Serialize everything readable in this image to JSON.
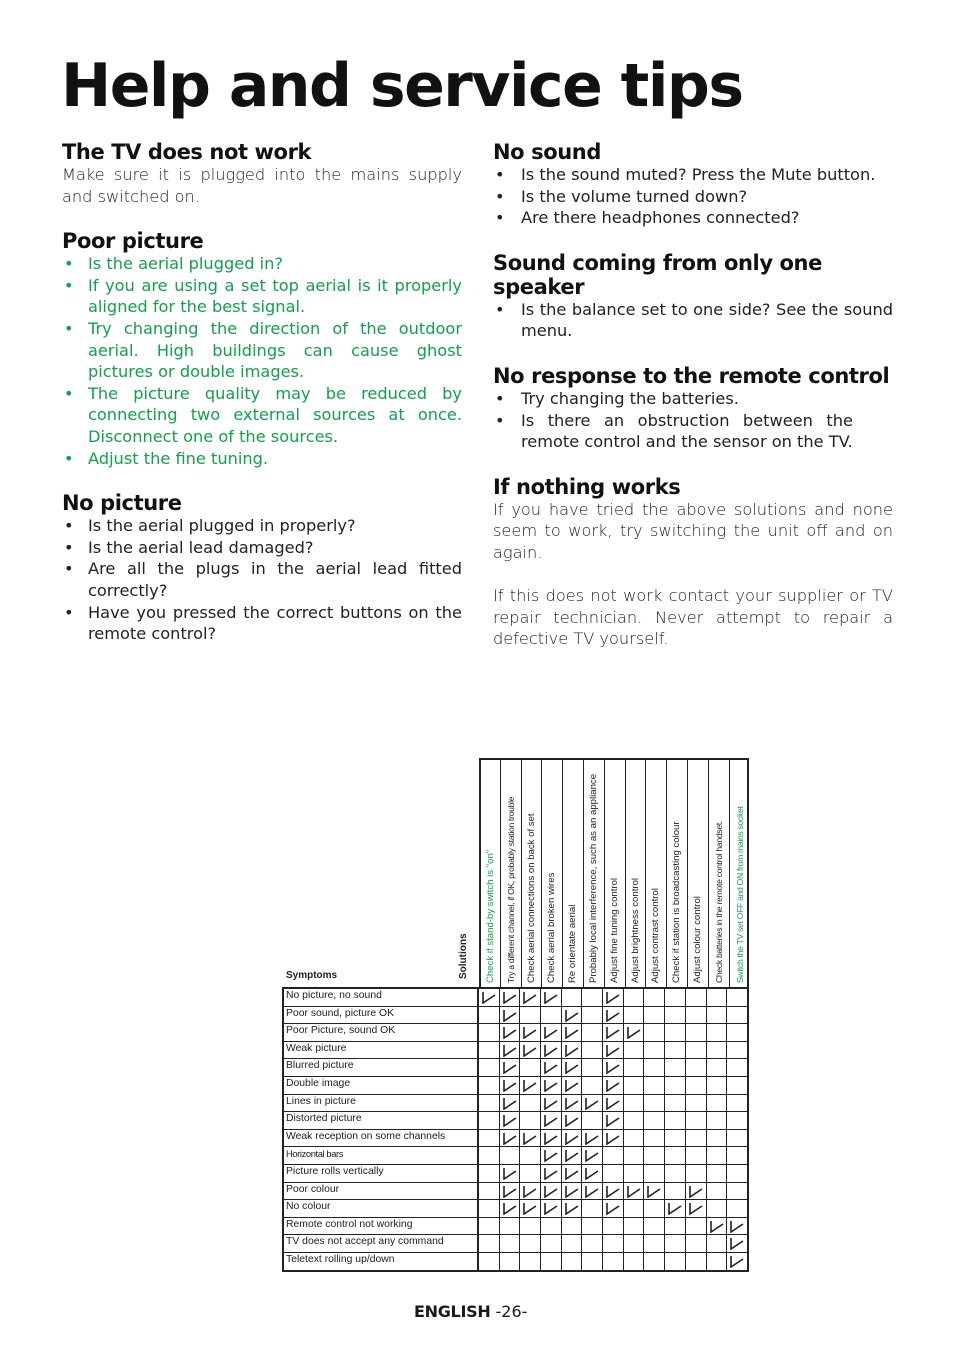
{
  "title": "Help and service tips",
  "left_column": {
    "tv_not_work": {
      "heading": "The TV does not work",
      "text": "Make sure it is plugged into the mains supply and switched on."
    },
    "poor_picture": {
      "heading": "Poor picture",
      "items": [
        "Is the aerial plugged in?",
        "If you are using a set top aerial is it properly aligned for the best signal.",
        "Try changing the direction of the outdoor aerial.  High buildings can cause ghost pictures or double images.",
        "The picture quality may be reduced by connecting two external sources at once. Disconnect one of the sources.",
        "Adjust the fine tuning."
      ]
    },
    "no_picture": {
      "heading": "No picture",
      "items": [
        "Is the aerial plugged in properly?",
        "Is the aerial lead damaged?",
        "Are all the plugs in the aerial lead fitted correctly?",
        "Have you pressed the correct buttons on the remote control?"
      ]
    }
  },
  "right_column": {
    "no_sound": {
      "heading": "No sound",
      "items": [
        "Is the sound muted?  Press the Mute button.",
        "Is the volume turned down?",
        "Are there headphones connected?"
      ]
    },
    "one_speaker": {
      "heading": "Sound coming from only one speaker",
      "items": [
        "Is the balance set to one side?  See the sound menu."
      ]
    },
    "no_remote": {
      "heading": "No response to the remote control",
      "items": [
        "Try changing the batteries.",
        "Is there an obstruction between the remote control and the sensor on the TV."
      ]
    },
    "nothing_works": {
      "heading": "If nothing works",
      "paragraphs": [
        "If you have tried the above solutions and none seem to work, try switching the unit off and on again.",
        "If this does not work contact your supplier or TV repair technician. Never attempt to repair a defective TV yourself."
      ]
    }
  },
  "bullet": "•",
  "colors": {
    "accent_green": "#12a14b",
    "text": "#222222"
  },
  "table": {
    "symptoms_label": "Symptoms",
    "solutions_label": "Solutions",
    "solutions": [
      {
        "label": "Check if stand-by switch is \"on\"",
        "green": true
      },
      {
        "label": "Try a different channel, if OK, probably station trouble",
        "green": false,
        "small": true
      },
      {
        "label": "Check aerial connections on back of set",
        "green": false
      },
      {
        "label": "Check aerial broken wires",
        "green": false
      },
      {
        "label": "Re orientate aerial",
        "green": false
      },
      {
        "label": "Probably local interference, such as an appliance",
        "green": false
      },
      {
        "label": "Adjust fine tuning control",
        "green": false
      },
      {
        "label": "Adjust brightness control",
        "green": false
      },
      {
        "label": "Adjust contrast control",
        "green": false
      },
      {
        "label": "Check if station is broadcasting colour",
        "green": false
      },
      {
        "label": "Adjust colour control",
        "green": false
      },
      {
        "label": "Check batteries in the remote control handset.",
        "green": false,
        "small": true
      },
      {
        "label": "Switch the TV set OFF and ON from mains socket",
        "green": true,
        "small": true
      }
    ],
    "rows": [
      {
        "symptom": "No picture, no sound",
        "checks": [
          1,
          2,
          3,
          4,
          7
        ]
      },
      {
        "symptom": "Poor sound, picture OK",
        "checks": [
          2,
          5,
          7
        ]
      },
      {
        "symptom": "Poor Picture, sound OK",
        "checks": [
          2,
          3,
          4,
          5,
          7,
          8
        ]
      },
      {
        "symptom": "Weak picture",
        "checks": [
          2,
          3,
          4,
          5,
          7
        ]
      },
      {
        "symptom": "Blurred picture",
        "checks": [
          2,
          4,
          5,
          7
        ]
      },
      {
        "symptom": "Double image",
        "checks": [
          2,
          3,
          4,
          5,
          7
        ]
      },
      {
        "symptom": "Lines in picture",
        "checks": [
          2,
          4,
          5,
          6,
          7
        ]
      },
      {
        "symptom": "Distorted picture",
        "checks": [
          2,
          4,
          5,
          7
        ]
      },
      {
        "symptom": "Weak reception on some channels",
        "checks": [
          2,
          3,
          4,
          5,
          6,
          7
        ]
      },
      {
        "symptom": "Horizontal bars",
        "checks": [
          4,
          5,
          6
        ],
        "condensed": true
      },
      {
        "symptom": "Picture rolls vertically",
        "checks": [
          2,
          4,
          5,
          6
        ]
      },
      {
        "symptom": "Poor colour",
        "checks": [
          2,
          3,
          4,
          5,
          6,
          7,
          8,
          9,
          11
        ]
      },
      {
        "symptom": "No colour",
        "checks": [
          2,
          3,
          4,
          5,
          7,
          10,
          11
        ]
      },
      {
        "symptom": "Remote control not working",
        "checks": [
          12,
          13
        ]
      },
      {
        "symptom": "TV does not accept any command",
        "checks": [
          13
        ]
      },
      {
        "symptom": "Teletext rolling up/down",
        "checks": [
          13
        ]
      }
    ]
  },
  "footer": {
    "language": "ENGLISH",
    "page": "-26-"
  }
}
